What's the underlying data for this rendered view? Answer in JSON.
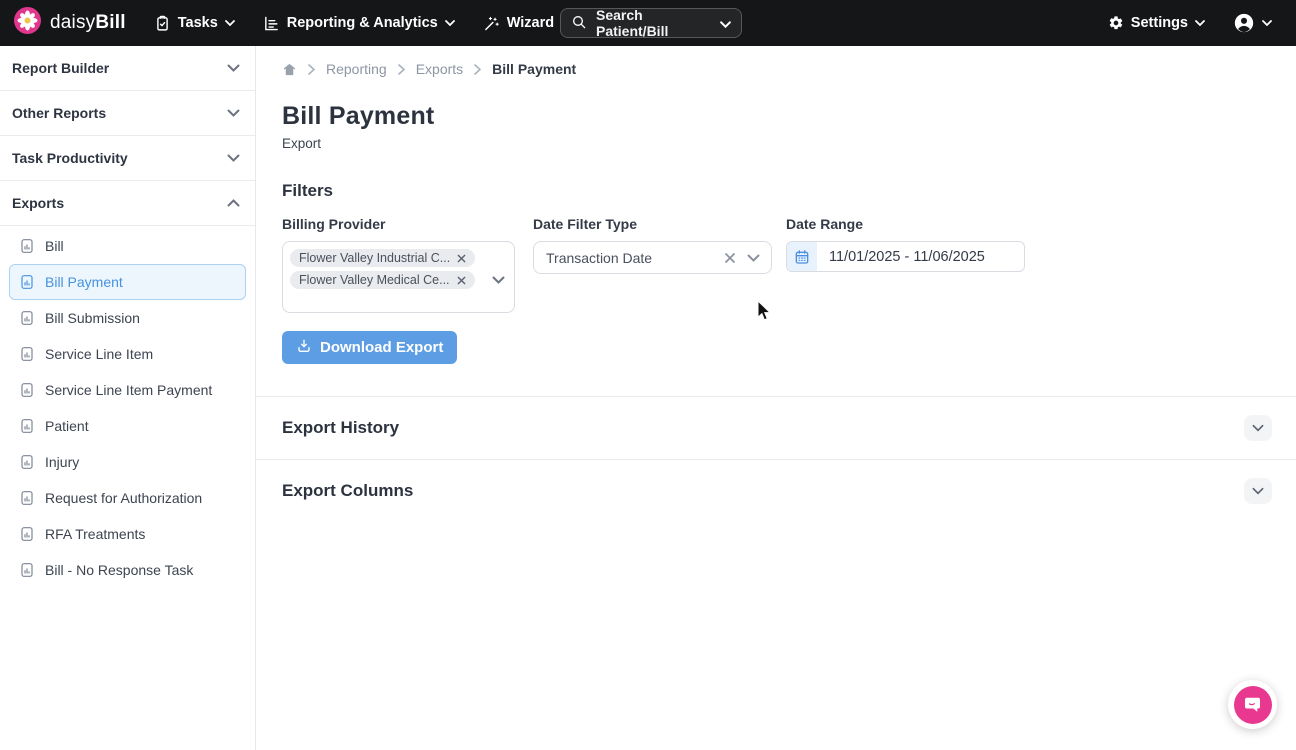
{
  "navbar": {
    "brand": {
      "daisy": "daisy",
      "bill": "Bill"
    },
    "items": [
      {
        "label": "Tasks"
      },
      {
        "label": "Reporting & Analytics"
      },
      {
        "label": "Wizard"
      }
    ],
    "search_label": "Search Patient/Bill",
    "settings_label": "Settings"
  },
  "sidebar": {
    "sections": [
      {
        "label": "Report Builder",
        "state": "collapsed"
      },
      {
        "label": "Other Reports",
        "state": "collapsed"
      },
      {
        "label": "Task Productivity",
        "state": "collapsed"
      },
      {
        "label": "Exports",
        "state": "expanded"
      }
    ],
    "export_items": [
      {
        "label": "Bill"
      },
      {
        "label": "Bill Payment",
        "selected": true
      },
      {
        "label": "Bill Submission"
      },
      {
        "label": "Service Line Item"
      },
      {
        "label": "Service Line Item Payment"
      },
      {
        "label": "Patient"
      },
      {
        "label": "Injury"
      },
      {
        "label": "Request for Authorization"
      },
      {
        "label": "RFA Treatments"
      },
      {
        "label": "Bill - No Response Task"
      }
    ]
  },
  "breadcrumb": {
    "items": [
      {
        "label": "Reporting"
      },
      {
        "label": "Exports"
      },
      {
        "label": "Bill Payment",
        "current": true
      }
    ]
  },
  "page": {
    "title": "Bill Payment",
    "subtitle": "Export"
  },
  "filters": {
    "heading": "Filters",
    "billing_provider": {
      "label": "Billing Provider",
      "chips": [
        {
          "label": "Flower Valley Industrial C..."
        },
        {
          "label": "Flower Valley Medical Ce..."
        }
      ]
    },
    "date_filter_type": {
      "label": "Date Filter Type",
      "value": "Transaction Date"
    },
    "date_range": {
      "label": "Date Range",
      "value": "11/01/2025 - 11/06/2025"
    }
  },
  "actions": {
    "download_label": "Download Export"
  },
  "sections": [
    {
      "title": "Export History"
    },
    {
      "title": "Export Columns"
    }
  ],
  "colors": {
    "brand_pink": "#e0368c",
    "accent_blue": "#4593dd",
    "button_blue": "#5d9de4",
    "selected_bg": "#eef6fd",
    "selected_border": "#aed0f2",
    "navbar_bg": "#151618",
    "chat_pink": "#e8388f"
  }
}
